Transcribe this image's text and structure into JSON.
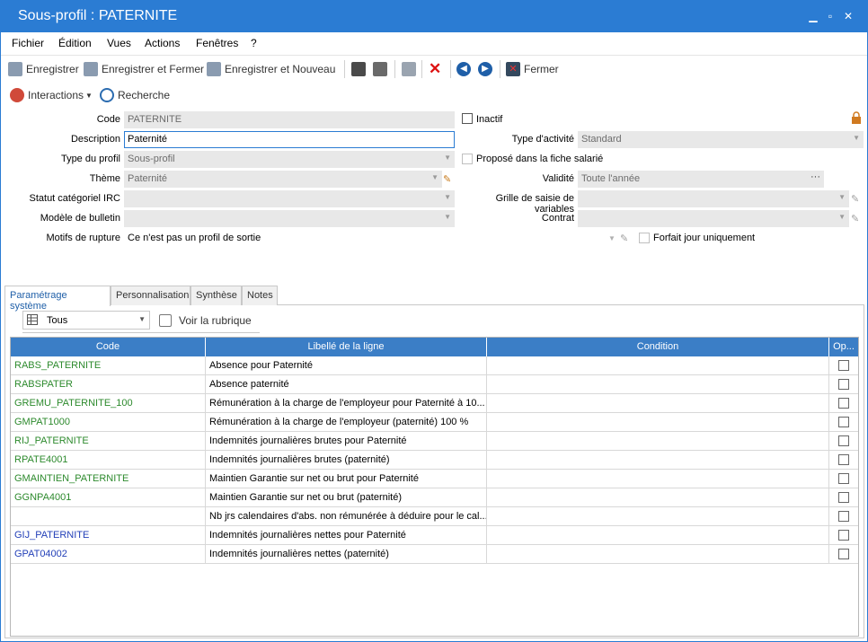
{
  "window": {
    "title": "Sous-profil : PATERNITE"
  },
  "menu": [
    "Fichier",
    "Édition",
    "Vues",
    "Actions",
    "Fenêtres",
    "?"
  ],
  "toolbar": {
    "save": "Enregistrer",
    "save_close": "Enregistrer et Fermer",
    "save_new": "Enregistrer et Nouveau",
    "close": "Fermer"
  },
  "toolbar2": {
    "interactions": "Interactions",
    "search": "Recherche"
  },
  "form": {
    "code_label": "Code",
    "code_value": "PATERNITE",
    "description_label": "Description",
    "description_value": "Paternité",
    "profile_type_label": "Type du profil",
    "profile_type_value": "Sous-profil",
    "theme_label": "Thème",
    "theme_value": "Paternité",
    "irc_label": "Statut catégoriel IRC",
    "irc_value": "",
    "bulletin_label": "Modèle de bulletin",
    "bulletin_value": "",
    "rupture_label": "Motifs de rupture",
    "rupture_value": "Ce n'est pas un profil de sortie",
    "inactive_label": "Inactif",
    "activity_label": "Type d'activité",
    "activity_value": "Standard",
    "proposed_label": "Proposé dans la fiche salarié",
    "validity_label": "Validité",
    "validity_value": "Toute l'année",
    "variables_label": "Grille de saisie de variables",
    "variables_value": "",
    "contract_label": "Contrat",
    "contract_value": "",
    "forfait_label": "Forfait jour uniquement"
  },
  "tabs": [
    "Paramétrage système",
    "Personnalisation",
    "Synthèse",
    "Notes"
  ],
  "grid_toolbar": {
    "filter": "Tous",
    "view_item": "Voir la rubrique"
  },
  "grid": {
    "headers": [
      "Code",
      "Libellé de la ligne",
      "Condition",
      "Op..."
    ],
    "rows": [
      {
        "code": "RABS_PATERNITE",
        "label": "Absence pour Paternité",
        "condition": "",
        "color": "#2d8a2d"
      },
      {
        "code": "RABSPATER",
        "label": "Absence paternité",
        "condition": "",
        "color": "#2d8a2d"
      },
      {
        "code": "GREMU_PATERNITE_100",
        "label": "Rémunération à la charge de l'employeur pour Paternité à 10...",
        "condition": "",
        "color": "#2d8a2d"
      },
      {
        "code": "GMPAT1000",
        "label": "Rémunération à la charge de l'employeur (paternité) 100 %",
        "condition": "",
        "color": "#2d8a2d"
      },
      {
        "code": "RIJ_PATERNITE",
        "label": "Indemnités journalières brutes pour Paternité",
        "condition": "",
        "color": "#2d8a2d"
      },
      {
        "code": "RPATE4001",
        "label": "Indemnités journalières brutes (paternité)",
        "condition": "",
        "color": "#2d8a2d"
      },
      {
        "code": "GMAINTIEN_PATERNITE",
        "label": "Maintien Garantie sur net ou brut pour Paternité",
        "condition": "",
        "color": "#2d8a2d"
      },
      {
        "code": "GGNPA4001",
        "label": "Maintien Garantie sur net ou brut (paternité)",
        "condition": "",
        "color": "#2d8a2d"
      },
      {
        "code": "",
        "label": "Nb jrs calendaires d'abs. non rémunérée à déduire pour le cal...",
        "condition": "",
        "color": "#2d8a2d"
      },
      {
        "code": "GIJ_PATERNITE",
        "label": "Indemnités journalières nettes pour Paternité",
        "condition": "",
        "color": "#2340b8"
      },
      {
        "code": "GPAT04002",
        "label": "Indemnités journalières nettes (paternité)",
        "condition": "",
        "color": "#2340b8"
      }
    ]
  }
}
